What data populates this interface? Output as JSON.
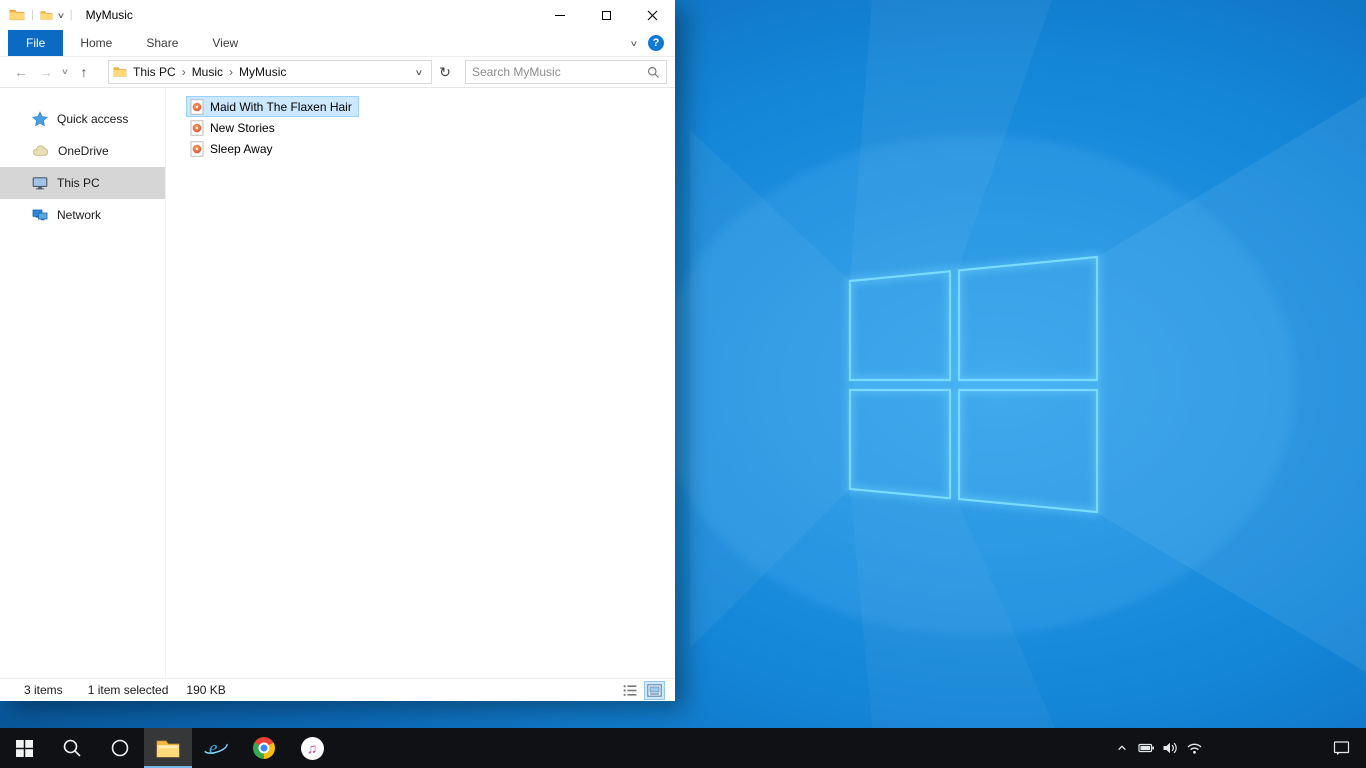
{
  "colors": {
    "accent_blue": "#0b6ac4",
    "file_selection_fill": "#cce8ff",
    "file_selection_border": "#99d1ff",
    "nav_selected_gray": "#d6d6d6",
    "wallpaper_blue": "#1486d8",
    "logo_cyan": "#79dbff",
    "taskbar_bg": "#101114"
  },
  "explorer": {
    "title_bar": {
      "title": "MyMusic"
    },
    "ribbon": {
      "file_tab_label": "File",
      "tabs": [
        {
          "label": "Home"
        },
        {
          "label": "Share"
        },
        {
          "label": "View"
        }
      ],
      "help_label": "?"
    },
    "address_bar": {
      "breadcrumb": [
        {
          "label": "This PC"
        },
        {
          "label": "Music"
        },
        {
          "label": "MyMusic"
        }
      ],
      "search_placeholder": "Search MyMusic"
    },
    "sidebar": {
      "items": [
        {
          "label": "Quick access",
          "icon": "star"
        },
        {
          "label": "OneDrive",
          "icon": "cloud"
        },
        {
          "label": "This PC",
          "icon": "computer",
          "selected": true
        },
        {
          "label": "Network",
          "icon": "network"
        }
      ]
    },
    "file_list": {
      "items": [
        {
          "name": "Maid With The Flaxen Hair",
          "icon": "audio-file",
          "selected": true
        },
        {
          "name": "New Stories",
          "icon": "audio-file",
          "selected": false
        },
        {
          "name": "Sleep Away",
          "icon": "audio-file",
          "selected": false
        }
      ]
    },
    "status_bar": {
      "items_count": "3 items",
      "selection_count": "1 item selected",
      "selection_size": "190 KB"
    }
  },
  "icons": {
    "back": "←",
    "forward": "→",
    "up": "↑",
    "refresh": "↻",
    "recent_locations": "∨",
    "address_dropdown": "∨",
    "ribbon_collapse": "∨",
    "qat_customize": "∨",
    "breadcrumb_separator": "›",
    "qat_separator": "|"
  },
  "taskbar": {
    "buttons": [
      {
        "name": "start"
      },
      {
        "name": "search"
      },
      {
        "name": "cortana"
      },
      {
        "name": "file-explorer",
        "active": true
      },
      {
        "name": "internet-explorer"
      },
      {
        "name": "chrome"
      },
      {
        "name": "itunes"
      }
    ],
    "tray": [
      {
        "name": "hidden-icons"
      },
      {
        "name": "battery"
      },
      {
        "name": "volume"
      },
      {
        "name": "network"
      },
      {
        "name": "action-center"
      }
    ]
  }
}
